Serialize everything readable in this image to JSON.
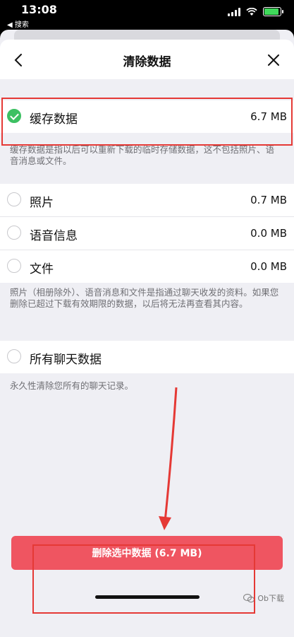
{
  "status_bar": {
    "time": "13:08",
    "back_app": "◀ 搜索"
  },
  "nav": {
    "title": "清除数据"
  },
  "cache_row": {
    "label": "缓存数据",
    "value": "6.7 MB",
    "checked": true
  },
  "cache_note": "缓存数据是指以后可以重新下载的临时存储数据，这不包括照片、语音消息或文件。",
  "media_rows": [
    {
      "label": "照片",
      "value": "0.7 MB",
      "checked": false
    },
    {
      "label": "语音信息",
      "value": "0.0 MB",
      "checked": false
    },
    {
      "label": "文件",
      "value": "0.0 MB",
      "checked": false
    }
  ],
  "media_note": "照片（相册除外）、语音消息和文件是指通过聊天收发的资料。如果您删除已超过下载有效期限的数据，以后将无法再查看其内容。",
  "all_chats_row": {
    "label": "所有聊天数据",
    "checked": false
  },
  "all_chats_note": "永久性清除您所有的聊天记录。",
  "delete_button": "删除选中数据 (6.7 MB)",
  "watermark": "Ob下载",
  "colors": {
    "accent_green": "#3cc062",
    "delete_red": "#ef5561",
    "annotation_red": "#e53935"
  }
}
